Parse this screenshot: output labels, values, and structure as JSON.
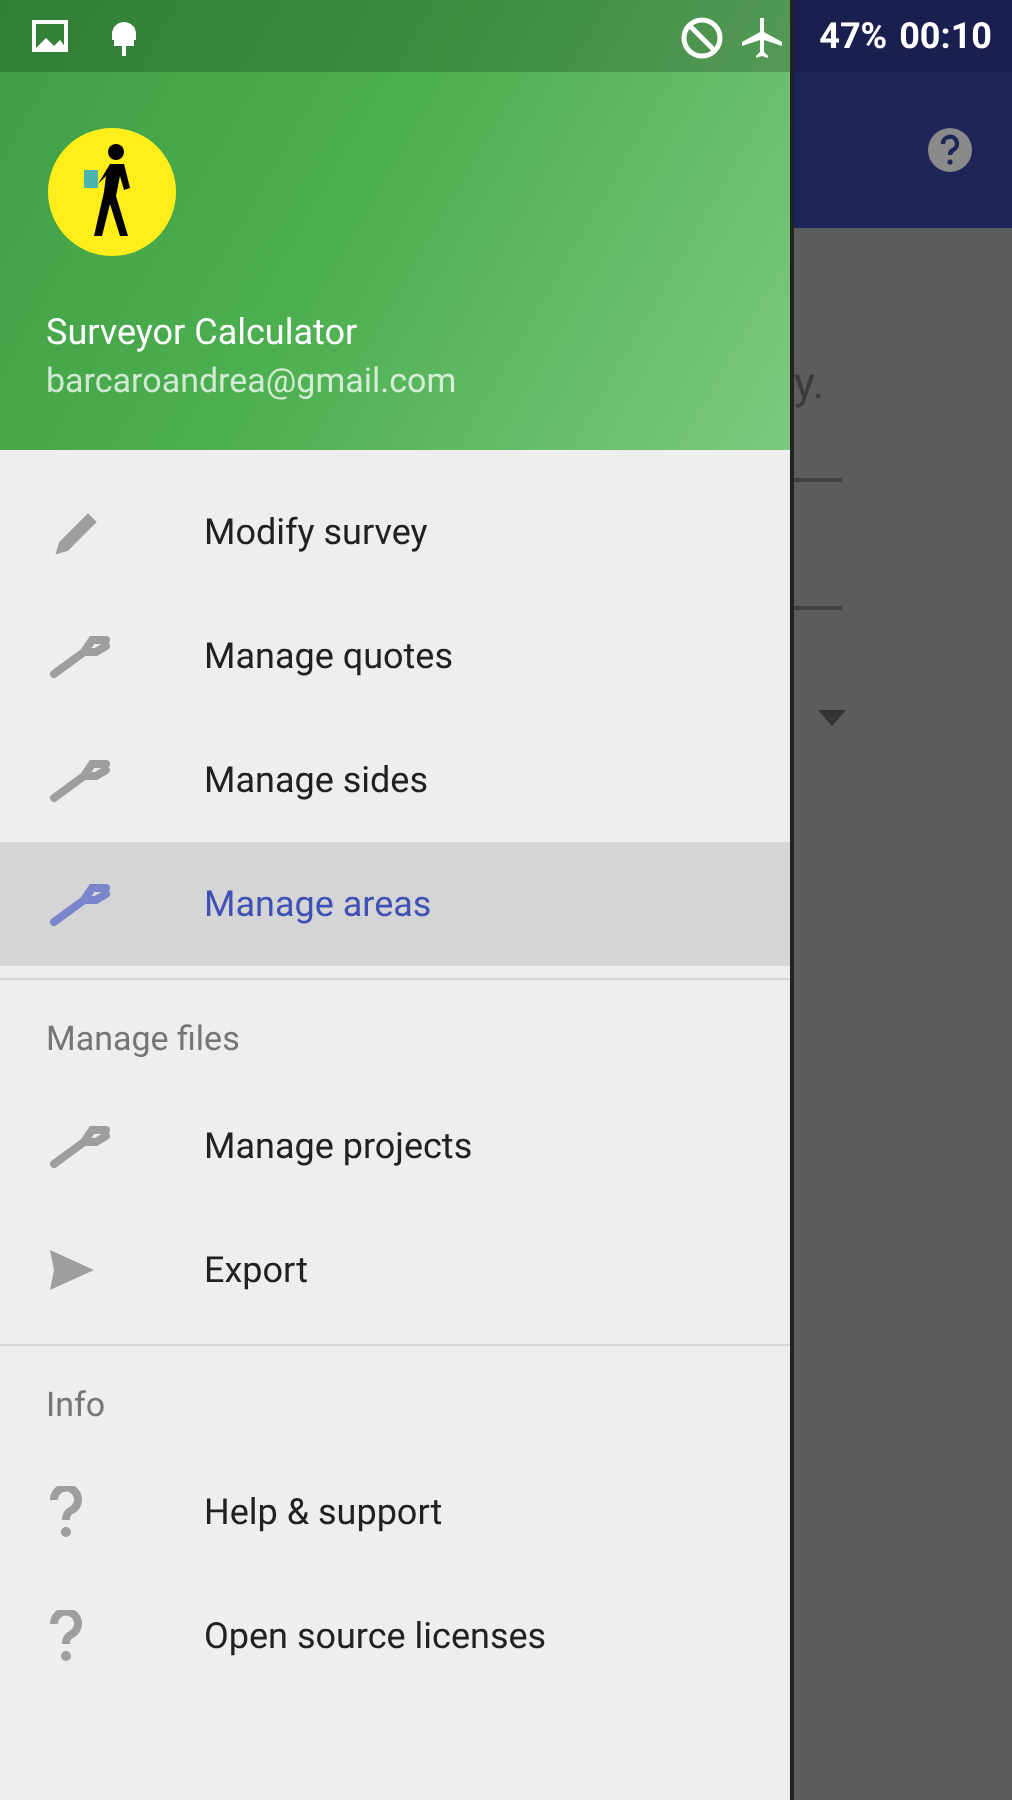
{
  "status_bar": {
    "battery": "47%",
    "time": "00:10"
  },
  "background_app": {
    "text": "y."
  },
  "drawer": {
    "header": {
      "title": "Surveyor Calculator",
      "email": "barcaroandrea@gmail.com"
    },
    "sections": [
      {
        "items": [
          {
            "label": "Modify survey",
            "kind": "pencil",
            "selected": false
          },
          {
            "label": "Manage quotes",
            "kind": "wrench",
            "selected": false
          },
          {
            "label": "Manage sides",
            "kind": "wrench",
            "selected": false
          },
          {
            "label": "Manage areas",
            "kind": "wrench",
            "selected": true
          }
        ]
      },
      {
        "title": "Manage files",
        "items": [
          {
            "label": "Manage projects",
            "kind": "wrench",
            "selected": false
          },
          {
            "label": "Export",
            "kind": "send",
            "selected": false
          }
        ]
      },
      {
        "title": "Info",
        "items": [
          {
            "label": "Help & support",
            "kind": "help",
            "selected": false
          },
          {
            "label": "Open source licenses",
            "kind": "help",
            "selected": false
          }
        ]
      }
    ]
  }
}
